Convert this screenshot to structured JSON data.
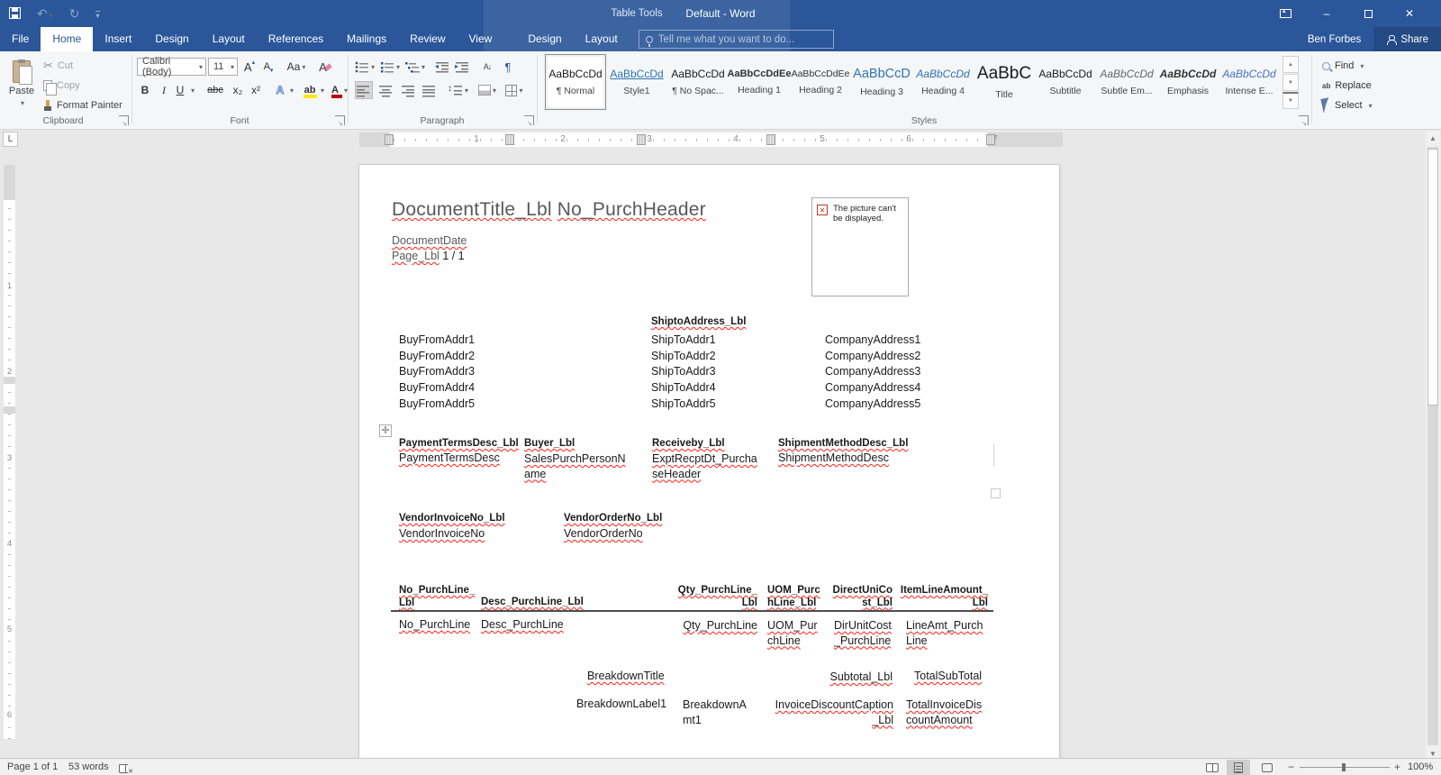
{
  "colors": {
    "accent_blue": "#2b579a",
    "squiggle_red": "#ff2116",
    "highlight_yellow": "#ffe713",
    "font_color_red": "#c00000",
    "style_blue": "#2e74b5"
  },
  "title_bar": {
    "context_title": "Table Tools",
    "title": "Default - Word",
    "user_name": "Ben Forbes",
    "share_label": "Share"
  },
  "tabs": {
    "file": "File",
    "main": [
      "Home",
      "Insert",
      "Design",
      "Layout",
      "References",
      "Mailings",
      "Review",
      "View"
    ],
    "contextual": [
      "Design",
      "Layout"
    ],
    "tell_me": "Tell me what you want to do..."
  },
  "icons": {
    "undo": "↶",
    "redo": "↻",
    "cut": "✂",
    "close": "✕",
    "minimize": "–",
    "dropdown": "▾",
    "scroll_up": "▲",
    "scroll_down": "▼",
    "pilcrow": "¶",
    "sort": "A↓",
    "replace_ab": "ab",
    "pic_error_x": "✕",
    "table_move": "✛"
  },
  "ribbon": {
    "clipboard": {
      "group_label": "Clipboard",
      "paste": "Paste",
      "cut": "Cut",
      "copy": "Copy",
      "format_painter": "Format Painter"
    },
    "font": {
      "group_label": "Font",
      "font_name": "Calibri (Body)",
      "font_size": "11",
      "bold": "B",
      "italic": "I",
      "underline": "U",
      "strikethrough": "abc",
      "subscript": "x₂",
      "superscript": "x²",
      "change_case": "Aa",
      "effects": "A",
      "highlight": "ab",
      "font_color": "A"
    },
    "paragraph": {
      "group_label": "Paragraph"
    },
    "styles": {
      "group_label": "Styles",
      "items": [
        {
          "sample": "AaBbCcDd",
          "name": "¶ Normal"
        },
        {
          "sample": "AaBbCcDd",
          "name": "Style1"
        },
        {
          "sample": "AaBbCcDd",
          "name": "¶ No Spac..."
        },
        {
          "sample": "AaBbCcDdEe",
          "name": "Heading 1"
        },
        {
          "sample": "AaBbCcDdEe",
          "name": "Heading 2"
        },
        {
          "sample": "AaBbCcD",
          "name": "Heading 3"
        },
        {
          "sample": "AaBbCcDd",
          "name": "Heading 4"
        },
        {
          "sample": "AaBbC",
          "name": "Title"
        },
        {
          "sample": "AaBbCcDd",
          "name": "Subtitle"
        },
        {
          "sample": "AaBbCcDd",
          "name": "Subtle Em..."
        },
        {
          "sample": "AaBbCcDd",
          "name": "Emphasis"
        },
        {
          "sample": "AaBbCcDd",
          "name": "Intense E..."
        }
      ]
    },
    "editing": {
      "find": "Find",
      "replace": "Replace",
      "select": "Select"
    }
  },
  "ruler": {
    "horizontal_numbers": [
      "1",
      "2",
      "3",
      "4",
      "5",
      "6",
      "7"
    ],
    "vertical_numbers": [
      "1",
      "2",
      "3",
      "4",
      "5",
      "6"
    ]
  },
  "document": {
    "title_parts": [
      "DocumentTitle_Lbl",
      "No_PurchHeader"
    ],
    "date_field": "DocumentDate",
    "page_field": "Page_Lbl",
    "page_value": "1 / 1",
    "picture_placeholder": "The picture can't be displayed.",
    "shipto_header": "ShiptoAddress_Lbl",
    "buy_from": [
      "BuyFromAddr1",
      "BuyFromAddr2",
      "BuyFromAddr3",
      "BuyFromAddr4",
      "BuyFromAddr5"
    ],
    "ship_to": [
      "ShipToAddr1",
      "ShipToAddr2",
      "ShipToAddr3",
      "ShipToAddr4",
      "ShipToAddr5"
    ],
    "company": [
      "CompanyAddress1",
      "CompanyAddress2",
      "CompanyAddress3",
      "CompanyAddress4",
      "CompanyAddress5"
    ],
    "info_labels": [
      "PaymentTermsDesc_Lbl",
      "Buyer_Lbl",
      "Receiveby_Lbl",
      "ShipmentMethodDesc_Lbl"
    ],
    "info_values": [
      "PaymentTermsDesc",
      "SalesPurchPersonName",
      "ExptRecptDt_PurchaseHeader",
      "ShipmentMethodDesc"
    ],
    "vendor_labels": [
      "VendorInvoiceNo_Lbl",
      "VendorOrderNo_Lbl"
    ],
    "vendor_values": [
      "VendorInvoiceNo",
      "VendorOrderNo"
    ],
    "line_header": [
      "No_PurchLine_Lbl",
      "Desc_PurchLine_Lbl",
      "Qty_PurchLine_Lbl",
      "UOM_PurchLine_Lbl",
      "DirectUniCost_Lbl",
      "ItemLineAmount_Lbl"
    ],
    "line_values": [
      "No_PurchLine",
      "Desc_PurchLine",
      "Qty_PurchLine",
      "UOM_PurchLine",
      "DirUnitCost_PurchLine",
      "LineAmt_PurchLine"
    ],
    "breakdown_title": "BreakdownTitle",
    "subtotal_lbl": "Subtotal_Lbl",
    "total_subtotal": "TotalSubTotal",
    "breakdown_label1": "BreakdownLabel1",
    "breakdown_amt1": "BreakdownAmt1",
    "invoice_discount_caption": "InvoiceDiscountCaption_Lbl",
    "total_invoice_discount": "TotalInvoiceDiscountAmount"
  },
  "status_bar": {
    "page_indicator": "Page 1 of 1",
    "word_count": "53 words",
    "zoom_level": "100%"
  }
}
